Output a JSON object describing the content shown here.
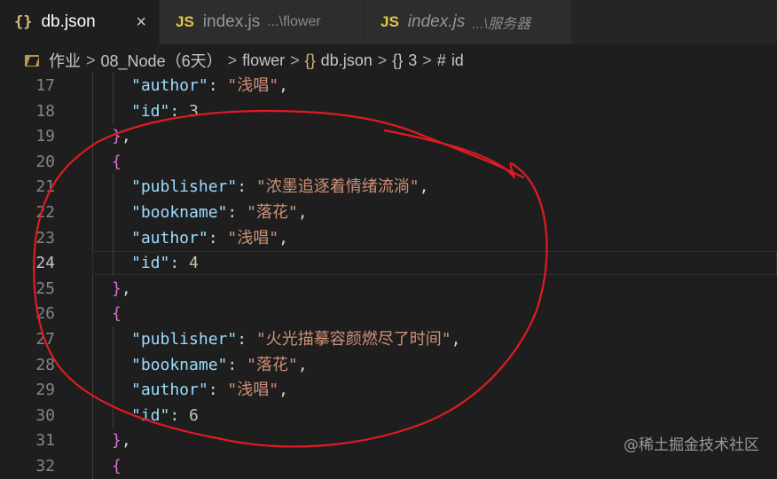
{
  "tabs": [
    {
      "icon": "{}",
      "name": "db.json",
      "path": "",
      "active": true,
      "close": "×"
    },
    {
      "icon": "JS",
      "name": "index.js",
      "path": "...\\flower",
      "active": false
    },
    {
      "icon": "JS",
      "name": "index.js",
      "path": "...\\服务器",
      "active": false
    }
  ],
  "breadcrumb": {
    "items": [
      "作业",
      "08_Node（6天）",
      "flower",
      "db.json",
      "3",
      "id"
    ],
    "icons": {
      "json": "{}",
      "object": "{}",
      "field": "#"
    },
    "separator": ">"
  },
  "editor": {
    "current_line": 24,
    "lines": [
      {
        "num": "17",
        "indent": 1,
        "key": "\"author\"",
        "colon": ": ",
        "value": "\"浅唱\"",
        "vtype": "s",
        "tail": ","
      },
      {
        "num": "18",
        "indent": 1,
        "key": "\"id\"",
        "colon": ": ",
        "value": "3",
        "vtype": "n",
        "tail": ""
      },
      {
        "num": "19",
        "indent": 0,
        "brace": "}",
        "tail": ","
      },
      {
        "num": "20",
        "indent": 0,
        "brace": "{",
        "tail": ""
      },
      {
        "num": "21",
        "indent": 1,
        "key": "\"publisher\"",
        "colon": ": ",
        "value": "\"浓墨追逐着情绪流淌\"",
        "vtype": "s",
        "tail": ","
      },
      {
        "num": "22",
        "indent": 1,
        "key": "\"bookname\"",
        "colon": ": ",
        "value": "\"落花\"",
        "vtype": "s",
        "tail": ","
      },
      {
        "num": "23",
        "indent": 1,
        "key": "\"author\"",
        "colon": ": ",
        "value": "\"浅唱\"",
        "vtype": "s",
        "tail": ","
      },
      {
        "num": "24",
        "indent": 1,
        "key": "\"id\"",
        "colon": ": ",
        "value": "4",
        "vtype": "n",
        "tail": ""
      },
      {
        "num": "25",
        "indent": 0,
        "brace": "}",
        "tail": ","
      },
      {
        "num": "26",
        "indent": 0,
        "brace": "{",
        "tail": ""
      },
      {
        "num": "27",
        "indent": 1,
        "key": "\"publisher\"",
        "colon": ": ",
        "value": "\"火光描摹容颜燃尽了时间\"",
        "vtype": "s",
        "tail": ","
      },
      {
        "num": "28",
        "indent": 1,
        "key": "\"bookname\"",
        "colon": ": ",
        "value": "\"落花\"",
        "vtype": "s",
        "tail": ","
      },
      {
        "num": "29",
        "indent": 1,
        "key": "\"author\"",
        "colon": ": ",
        "value": "\"浅唱\"",
        "vtype": "s",
        "tail": ","
      },
      {
        "num": "30",
        "indent": 1,
        "key": "\"id\"",
        "colon": ": ",
        "value": "6",
        "vtype": "n",
        "tail": ""
      },
      {
        "num": "31",
        "indent": 0,
        "brace": "}",
        "tail": ","
      },
      {
        "num": "32",
        "indent": 0,
        "brace": "{",
        "tail": ""
      }
    ]
  },
  "watermark": "@稀土掘金技术社区",
  "colors": {
    "background": "#1e1e1e",
    "key": "#9cdcfe",
    "string": "#ce9178",
    "number": "#b5cea8",
    "bracket": "#da70d6",
    "annotation": "#e01b24"
  }
}
